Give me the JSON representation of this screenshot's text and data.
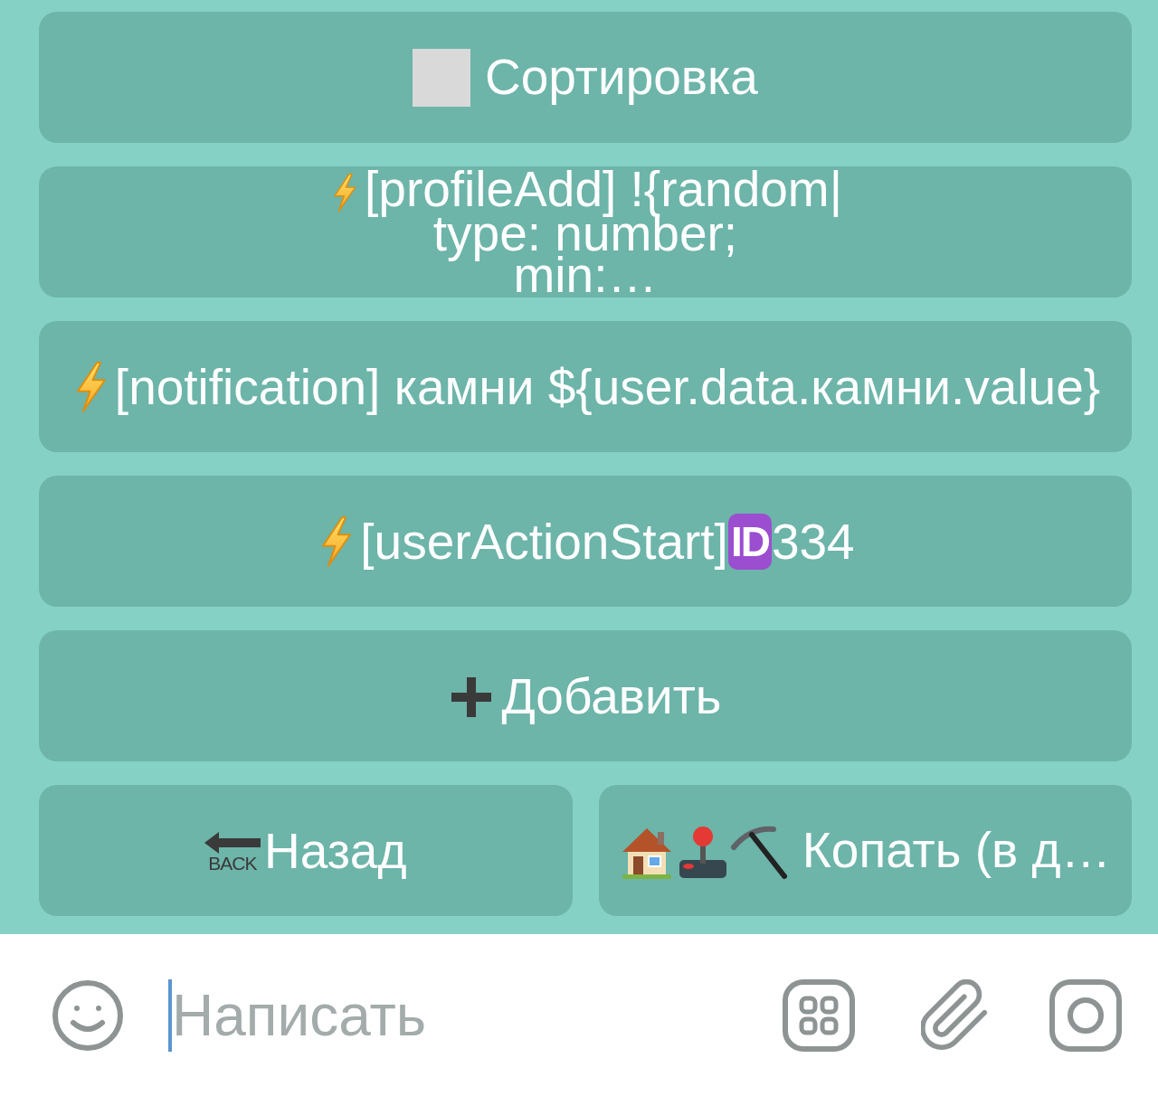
{
  "keyboard": {
    "rows": [
      [
        {
          "kind": "square",
          "label": "Сортировка"
        }
      ],
      [
        {
          "kind": "bolt",
          "label": "[profileAdd] !{random|\ntype: number;\nmin:…"
        }
      ],
      [
        {
          "kind": "bolt",
          "label": "[notification] камни ${user.data.камни.value}"
        }
      ],
      [
        {
          "kind": "bolt_id",
          "label": "[userActionStart]",
          "badge": "ID",
          "suffix": "334"
        }
      ],
      [
        {
          "kind": "plus",
          "label": "Добавить"
        }
      ],
      [
        {
          "kind": "back",
          "badge": "BACK",
          "label": "Назад"
        },
        {
          "kind": "tools",
          "label": "Копать (в д…"
        }
      ]
    ]
  },
  "composer": {
    "placeholder": "Написать"
  }
}
